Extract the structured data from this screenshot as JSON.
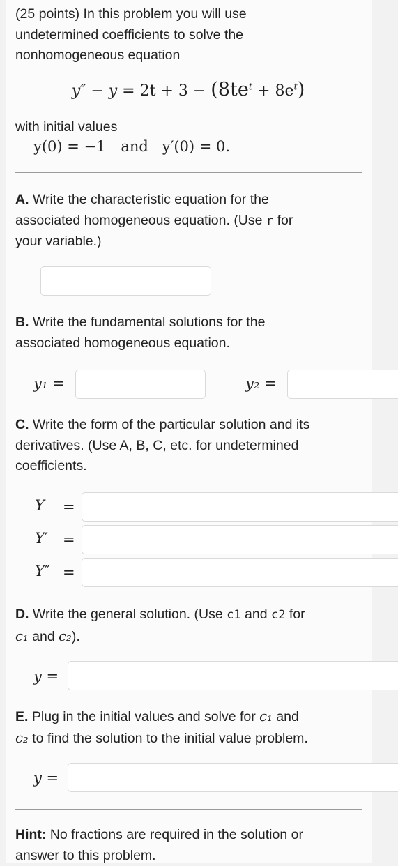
{
  "intro": {
    "line1": "(25 points) In this problem you will use",
    "line2": "undetermined coefficients to solve the",
    "line3": "nonhomogeneous equation"
  },
  "equation": {
    "lhs": "y″ − y",
    "rhs_a": " = 2t + 3 − ",
    "rhs_b": "(8te",
    "exp1": "t",
    "rhs_c": " + 8e",
    "exp2": "t",
    "rhs_d": ")"
  },
  "initial": {
    "intro": "with initial values",
    "cond1": "y(0) = −1",
    "and": "and",
    "cond2": "y′(0) = 0."
  },
  "partA": {
    "label": "A.",
    "line1": " Write the characteristic equation for the",
    "line2a": "associated homogeneous equation. (Use ",
    "var": "r",
    "line2b": " for",
    "line3": "your variable.)"
  },
  "partB": {
    "label": "B.",
    "line1": " Write the fundamental solutions for the",
    "line2": "associated homogeneous equation.",
    "y1": "y₁ =",
    "y2": "y₂ ="
  },
  "partC": {
    "label": "C.",
    "line1": " Write the form of the particular solution and its",
    "line2": "derivatives. (Use A, B, C, etc. for undetermined",
    "line3": "coefficients.",
    "Y": "Y",
    "Yp": "Y′",
    "Ypp": "Y″",
    "eq": "="
  },
  "partD": {
    "label": "D.",
    "line1a": " Write the general solution. (Use ",
    "c1code": "c1",
    "and": " and ",
    "c2code": "c2",
    "for": " for",
    "c1": "c₁",
    "and2": " and ",
    "c2": "c₂",
    "end": ").",
    "y": "y ="
  },
  "partE": {
    "label": "E.",
    "line1a": " Plug in the initial values and solve for ",
    "c1": "c₁",
    "line1b": " and",
    "c2": "c₂",
    "line2": " to find the solution to the initial value problem.",
    "y": "y ="
  },
  "hint": {
    "label": "Hint:",
    "line1": " No fractions are required in the solution or",
    "line2": "answer to this problem."
  }
}
